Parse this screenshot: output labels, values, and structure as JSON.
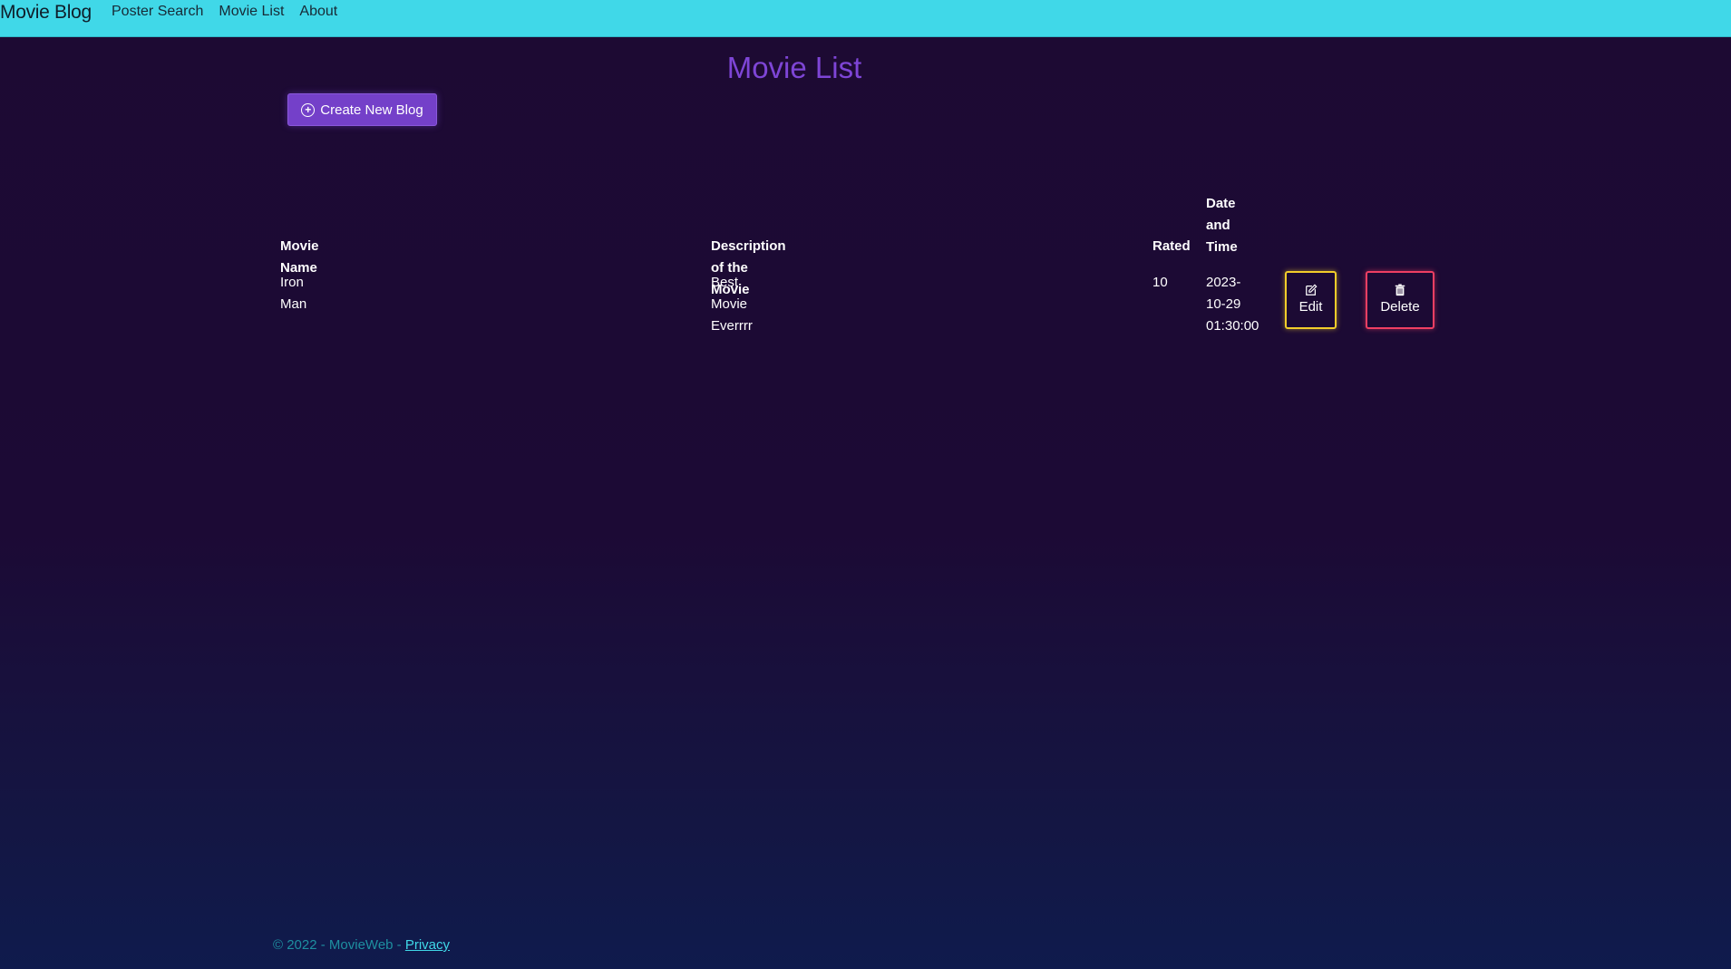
{
  "nav": {
    "brand": "Movie Blog",
    "links": [
      "Poster Search",
      "Movie List",
      "About"
    ]
  },
  "page": {
    "title": "Movie List",
    "create_button": "Create New Blog"
  },
  "table": {
    "headers": {
      "movie_name": "Movie Name",
      "description": "Description of the Movie",
      "rated": "Rated",
      "date_time": [
        "Date",
        "and",
        "Time"
      ]
    },
    "rows": [
      {
        "movie_name": "Iron Man",
        "description": "Best Movie Everrrr",
        "rated": "10",
        "date_time": [
          "2023-",
          "10-29",
          "01:30:00"
        ],
        "edit_label": "Edit",
        "delete_label": "Delete"
      }
    ]
  },
  "footer": {
    "text": "© 2022 - MovieWeb - ",
    "privacy_link": "Privacy"
  },
  "colors": {
    "navbar": "#40d8e8",
    "accent_purple": "#7440c9",
    "title_purple": "#7e45d6",
    "edit_border": "#f2cd2a",
    "delete_border": "#ef3f63",
    "background": "#1d0a33"
  },
  "icons": {
    "create": "plus-circle-icon",
    "edit": "pencil-square-icon",
    "delete": "trash-icon"
  }
}
